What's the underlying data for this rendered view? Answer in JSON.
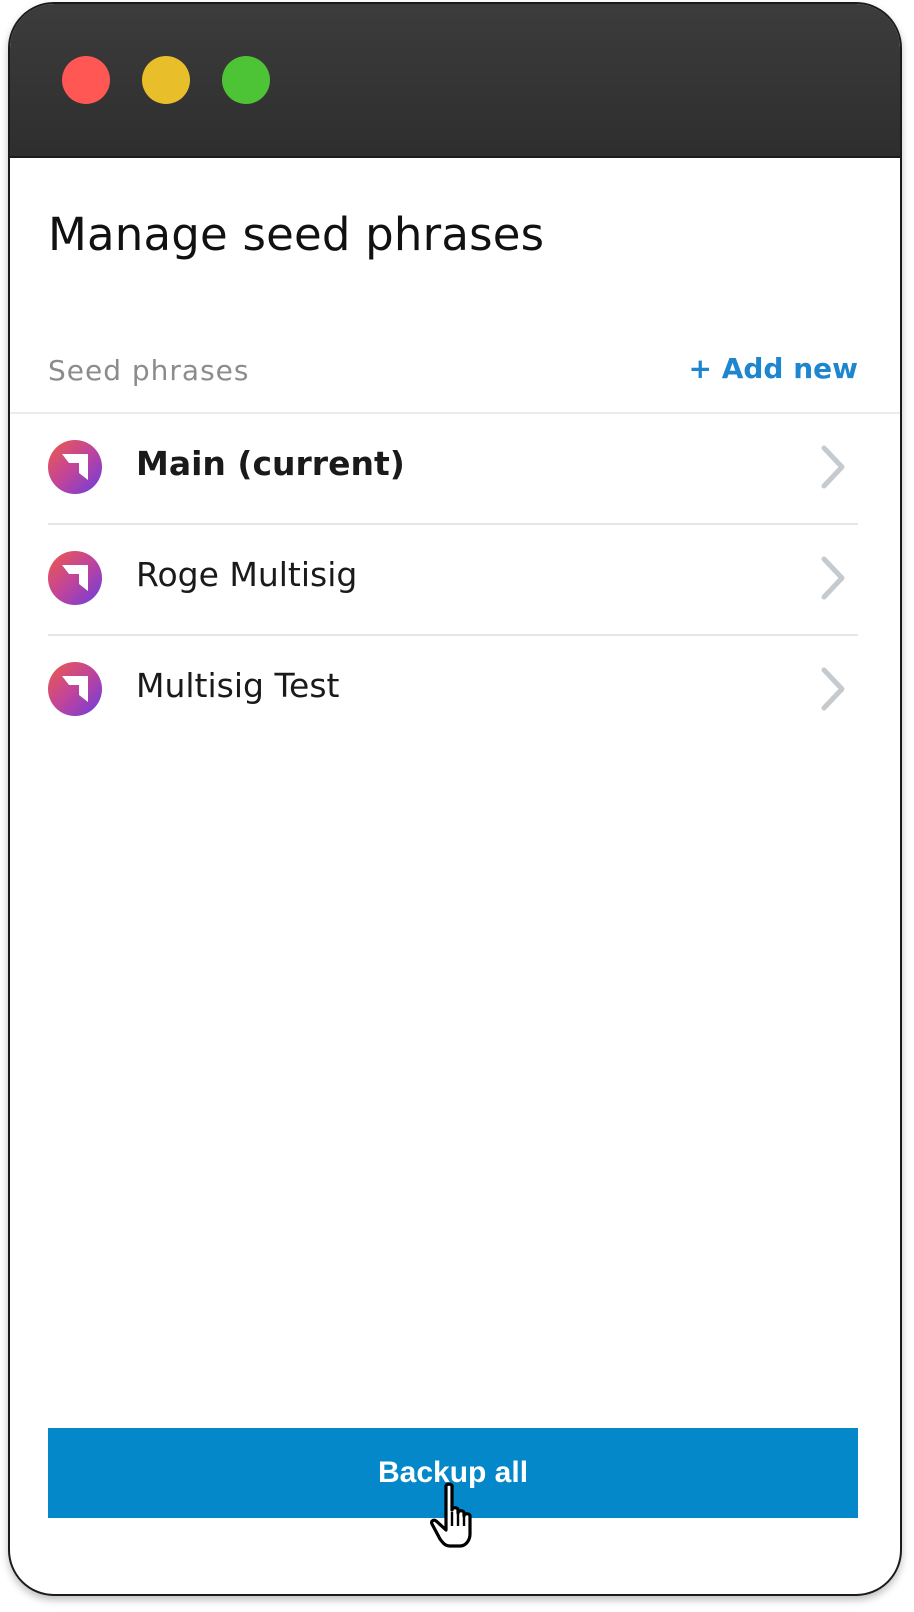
{
  "window": {
    "controls": [
      {
        "name": "close",
        "color": "#ff5754"
      },
      {
        "name": "minimize",
        "color": "#e8be2b"
      },
      {
        "name": "maximize",
        "color": "#4cc435"
      }
    ]
  },
  "page": {
    "title": "Manage seed phrases"
  },
  "section": {
    "label": "Seed phrases",
    "add_new_label": "+ Add new"
  },
  "seed_phrases": [
    {
      "name": "Main (current)",
      "current": true,
      "icon": "wallet-logo-icon"
    },
    {
      "name": "Roge Multisig",
      "current": false,
      "icon": "wallet-logo-icon"
    },
    {
      "name": "Multisig Test",
      "current": false,
      "icon": "wallet-logo-icon"
    }
  ],
  "footer": {
    "backup_label": "Backup all"
  },
  "colors": {
    "accent": "#0588c9",
    "link": "#1e86cf",
    "chevron": "#c5cace",
    "titlebar": "#353535"
  },
  "icons": {
    "row_chevron": "chevron-right-icon",
    "pointer": "hand-pointer-icon"
  }
}
